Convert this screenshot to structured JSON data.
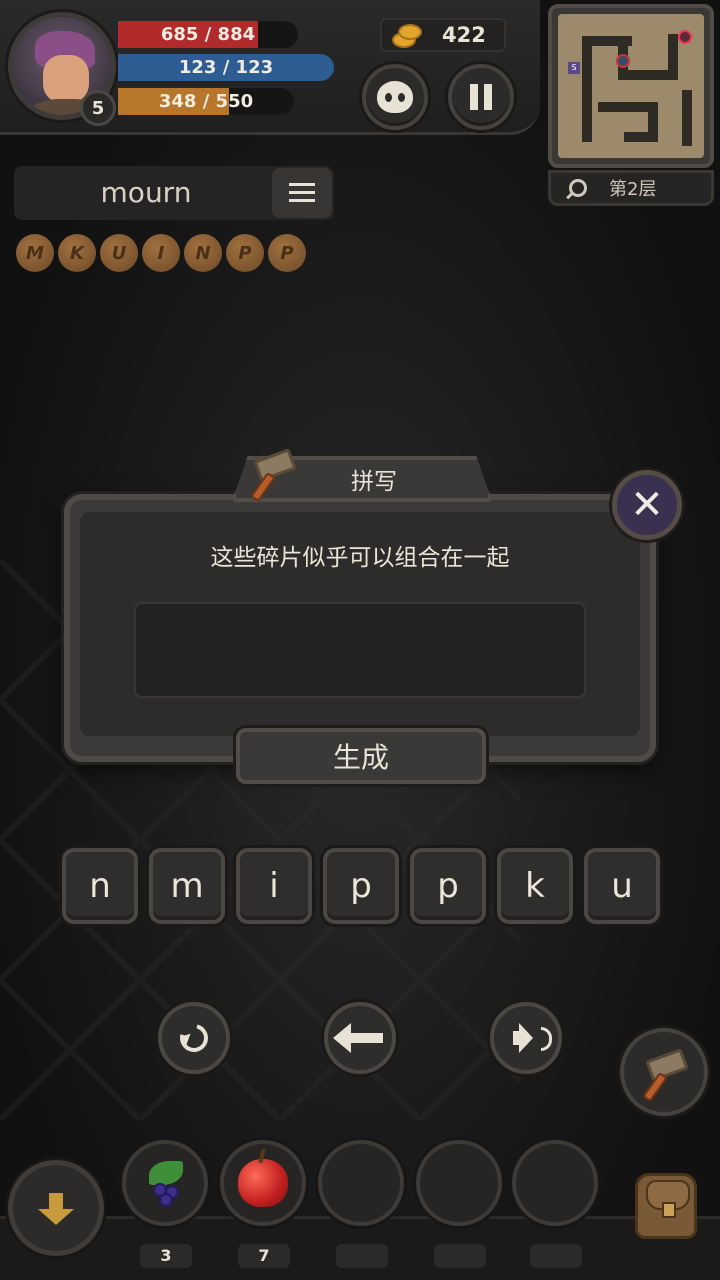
{
  "hud": {
    "level": "5",
    "hp": {
      "text": "685 / 884",
      "fraction": 0.775,
      "color": "#b22a2a"
    },
    "mp": {
      "text": "123 / 123",
      "fraction": 1.0,
      "color": "#2d5d93"
    },
    "xp": {
      "text": "348 / 550",
      "fraction": 0.633,
      "color": "#b8762a"
    },
    "gold": "422",
    "floor": "第2层",
    "minimap_marker": "S"
  },
  "word": {
    "current": "mourn"
  },
  "rune_fragments": [
    "M",
    "K",
    "U",
    "I",
    "N",
    "P",
    "P"
  ],
  "dialog": {
    "title": "拼写",
    "message": "这些碎片似乎可以组合在一起",
    "answer_value": "",
    "generate_label": "生成",
    "close_label": "✕"
  },
  "letters": [
    "n",
    "m",
    "i",
    "p",
    "p",
    "k",
    "u"
  ],
  "inventory": {
    "slots": [
      {
        "item": "berry-icon",
        "count": "3"
      },
      {
        "item": "apple-icon",
        "count": "7"
      },
      {
        "item": "",
        "count": ""
      },
      {
        "item": "",
        "count": ""
      },
      {
        "item": "",
        "count": ""
      }
    ]
  },
  "icons": {
    "pet": "pet-icon",
    "pause": "pause-icon",
    "search": "search-icon",
    "list": "list-icon",
    "undo": "undo-icon",
    "backspace": "back-icon",
    "sound": "sound-icon",
    "hammer": "hammer-icon",
    "drop": "down-icon",
    "bag": "bag-icon"
  }
}
